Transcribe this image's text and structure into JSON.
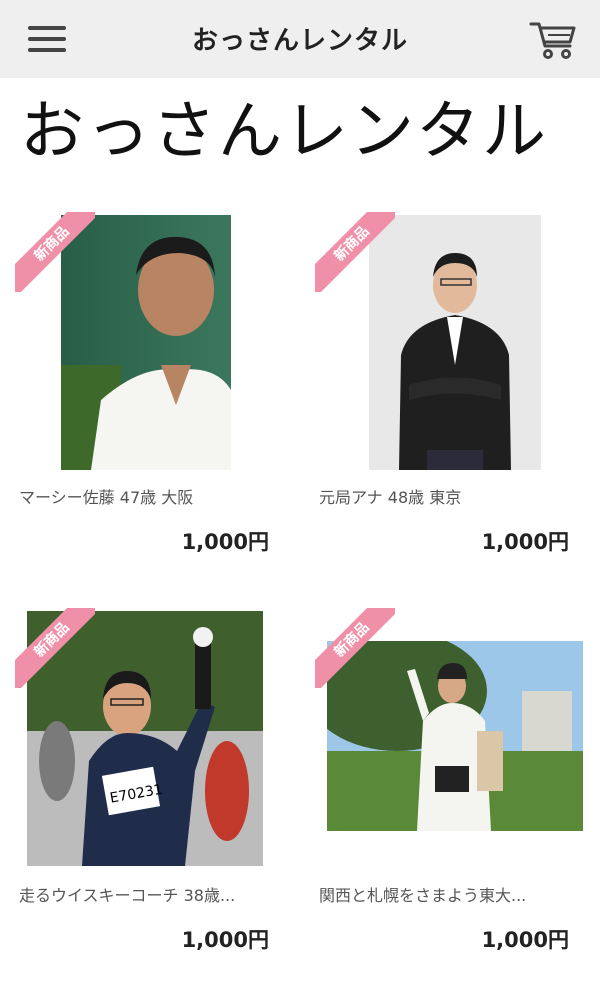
{
  "header": {
    "title": "おっさんレンタル",
    "menu_icon": "hamburger-menu-icon",
    "cart_icon": "shopping-cart-icon"
  },
  "page": {
    "title": "おっさんレンタル"
  },
  "products": [
    {
      "badge": "新商品",
      "name": "マーシー佐藤 47歳 大阪",
      "price": "1,000円"
    },
    {
      "badge": "新商品",
      "name": "元局アナ 48歳 東京",
      "price": "1,000円"
    },
    {
      "badge": "新商品",
      "name": "走るウイスキーコーチ 38歳...",
      "price": "1,000円"
    },
    {
      "badge": "新商品",
      "name": "関西と札幌をさまよう東大...",
      "price": "1,000円"
    }
  ],
  "colors": {
    "header_bg": "#efefef",
    "badge": "#ef8fa8",
    "text": "#222222"
  }
}
